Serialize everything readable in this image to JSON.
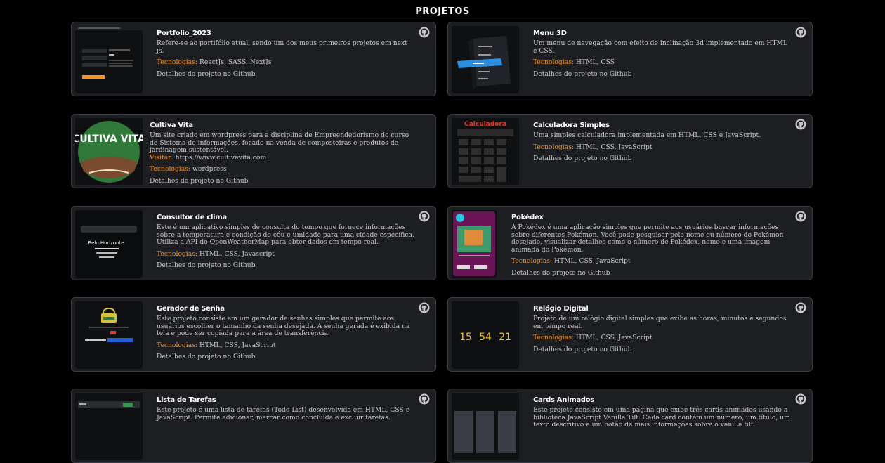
{
  "page": {
    "title": "PROJETOS"
  },
  "labels": {
    "tech_prefix": "Tecnologias:",
    "github_link": "Detalhes do projeto no Github",
    "visit_prefix": "Visitar:"
  },
  "projects": [
    {
      "title": "Portfolio_2023",
      "description": "Refere-se ao portifólio atual, sendo um dos meus primeiros projetos em next js.",
      "tech": "ReactJs, SASS, NextJs",
      "thumb_icon": "portfolio-screenshot"
    },
    {
      "title": "Menu 3D",
      "description": "Um menu de navegação com efeito de inclinação 3d implementado em HTML e CSS.",
      "tech": "HTML, CSS",
      "thumb_icon": "menu-3d-screenshot"
    },
    {
      "title": "Cultiva Vita",
      "description": "Um site criado em wordpress para a disciplina de Empreendedorismo do curso de Sistema de informações, focado na venda de composteiras e produtos de jardinagem sustentável.",
      "visit": "https://www.cultivavita.com",
      "tech": "wordpress",
      "thumb_icon": "cultiva-vita-logo",
      "thumb_text": "CULTIVA VITA"
    },
    {
      "title": "Calculadora Simples",
      "description": "Uma simples calculadora implementada em HTML, CSS e JavaScript.",
      "tech": "HTML, CSS, JavaScript",
      "thumb_icon": "calculator-screenshot",
      "thumb_text": "Calculadora"
    },
    {
      "title": "Consultor de clima",
      "description": "Este é um aplicativo simples de consulta do tempo que fornece informações sobre a temperatura e condição do céu e umidade para uma cidade específica. Utiliza a API do OpenWeatherMap para obter dados em tempo real.",
      "tech": "HTML, CSS, Javascript",
      "thumb_icon": "weather-screenshot",
      "thumb_text": "Belo Horizonte"
    },
    {
      "title": "Pokédex",
      "description": "A Pokédex é uma aplicação simples que permite aos usuários buscar informações sobre diferentes Pokémon. Você pode pesquisar pelo nome ou número do Pokémon desejado, visualizar detalhes como o número de Pokédex, nome e uma imagem animada do Pokémon.",
      "tech": "HTML, CSS, JavaScript",
      "thumb_icon": "pokedex-screenshot"
    },
    {
      "title": "Gerador de Senha",
      "description": "Este projeto consiste em um gerador de senhas simples que permite aos usuários escolher o tamanho da senha desejada. A senha gerada é exibida na tela e pode ser copiada para a área de transferência.",
      "tech": "HTML, CSS, JavaScript",
      "thumb_icon": "password-generator-screenshot"
    },
    {
      "title": "Relógio Digital",
      "description": "Projeto de um relógio digital simples que exibe as horas, minutos e segundos em tempo real.",
      "tech": "HTML, CSS, JavaScript",
      "thumb_icon": "digital-clock-screenshot",
      "clock": [
        "15",
        "54",
        "21"
      ]
    },
    {
      "title": "Lista de Tarefas",
      "description": "Este projeto é uma lista de tarefas (Todo List) desenvolvida em HTML, CSS e JavaScript. Permite adicionar, marcar como concluída e excluir tarefas.",
      "thumb_icon": "todo-list-screenshot"
    },
    {
      "title": "Cards Animados",
      "description": "Este projeto consiste em uma página que exibe três cards animados usando a biblioteca JavaScript Vanilla Tilt. Cada card contém um número, um título, um texto descritivo e um botão de mais informações sobre o vanilla tilt.",
      "thumb_icon": "animated-cards-screenshot"
    }
  ],
  "colors": {
    "accent": "#f7931e",
    "card_bg": "#1d1e22",
    "border": "#3b3d42"
  }
}
